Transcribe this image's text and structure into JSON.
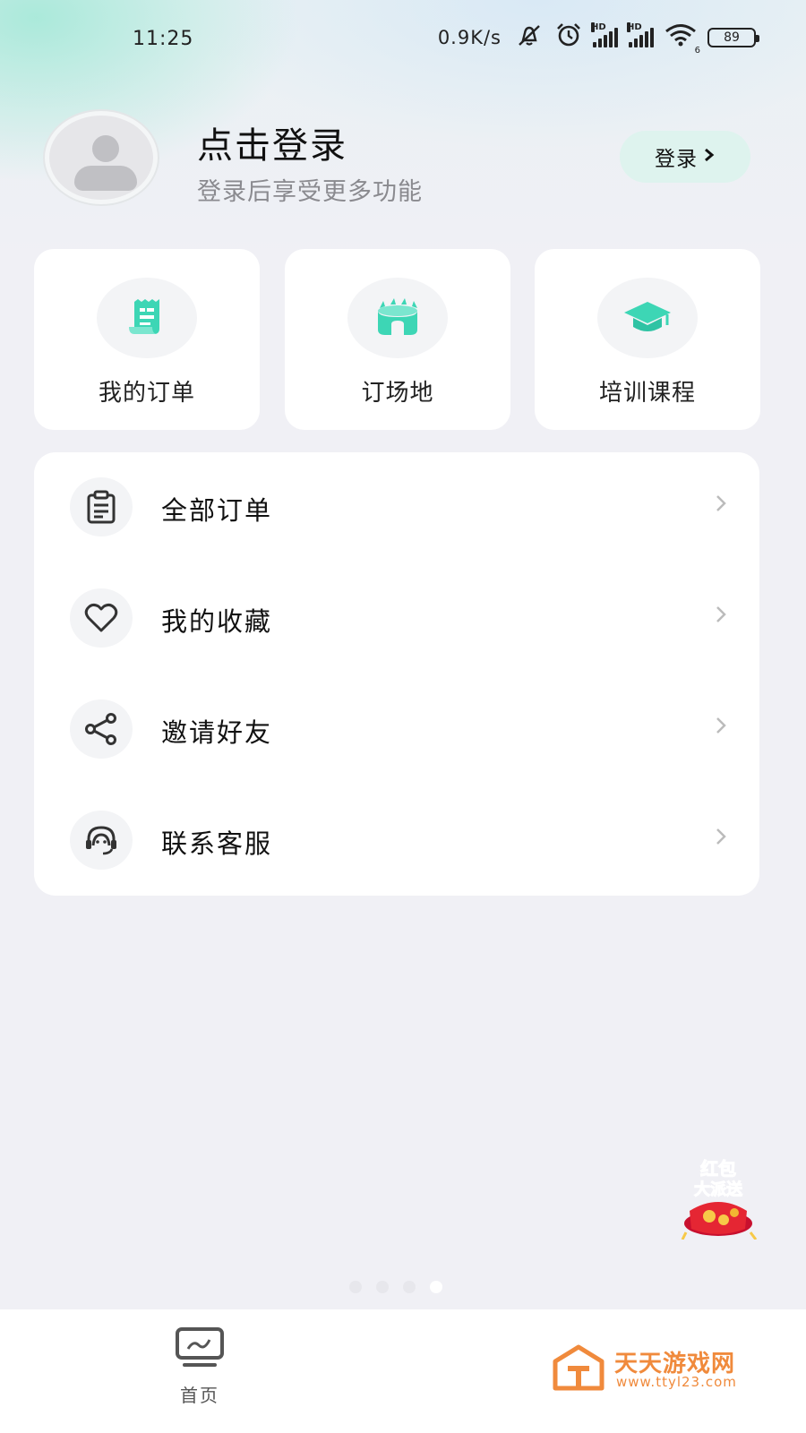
{
  "status_bar": {
    "time": "11:25",
    "net_speed": "0.9K/s",
    "signal_badge_1": "HD",
    "signal_badge_2": "HD",
    "wifi_badge": "6",
    "battery": "89"
  },
  "profile": {
    "title": "点击登录",
    "subtitle": "登录后享受更多功能",
    "login_button": "登录"
  },
  "quick_actions": [
    {
      "label": "我的订单",
      "icon": "receipt-icon"
    },
    {
      "label": "订场地",
      "icon": "stadium-icon"
    },
    {
      "label": "培训课程",
      "icon": "graduation-cap-icon"
    }
  ],
  "menu": [
    {
      "label": "全部订单",
      "icon": "clipboard-icon"
    },
    {
      "label": "我的收藏",
      "icon": "heart-icon"
    },
    {
      "label": "邀请好友",
      "icon": "share-icon"
    },
    {
      "label": "联系客服",
      "icon": "headset-icon"
    }
  ],
  "floating_banner": {
    "text_line1": "红包",
    "text_line2": "大派送"
  },
  "pager": {
    "count": 4,
    "active_index": 3
  },
  "bottom_nav": {
    "home_label": "首页"
  },
  "watermark": {
    "name": "天天游戏网",
    "url": "www.ttyl23.com"
  },
  "colors": {
    "accent": "#3dd6b5",
    "background": "#f0f0f5"
  }
}
